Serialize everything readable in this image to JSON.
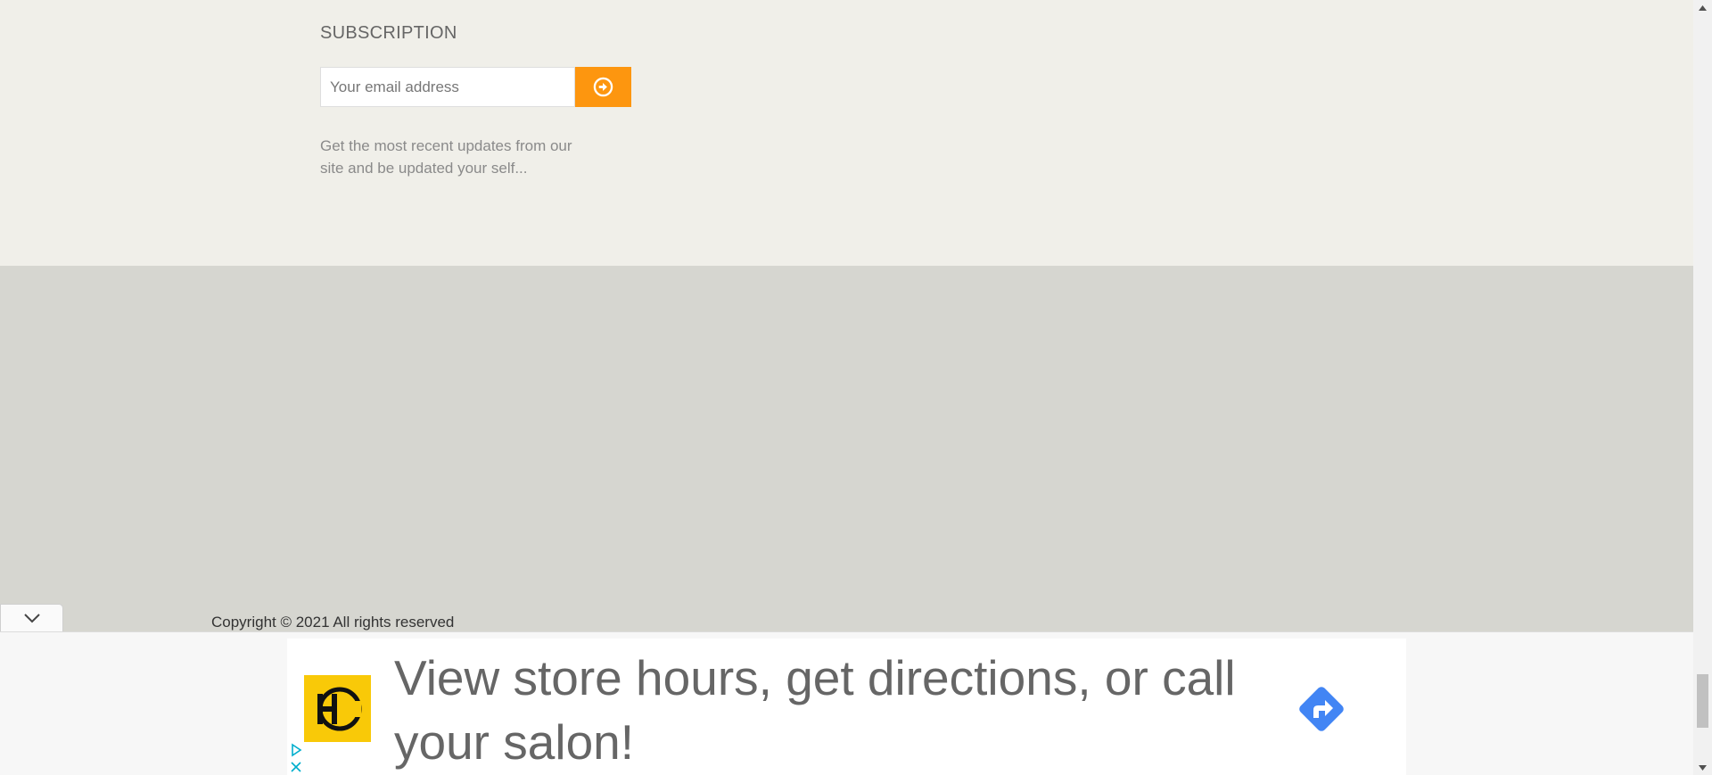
{
  "subscription": {
    "title": "SUBSCRIPTION",
    "email_placeholder": "Your email address",
    "submit_icon": "arrow-circle-right-icon",
    "description": "Get the most recent updates from our site and be updated your self..."
  },
  "footer": {
    "copyright": "Copyright © 2021 All rights reserved",
    "collapse_icon": "chevron-down-icon"
  },
  "ad": {
    "logo_text": "HC",
    "headline": "View store hours, get directions, or call your salon!",
    "direction_icon": "directions-icon",
    "adchoices_icon": "adchoices-icon",
    "close_icon": "close-icon"
  },
  "colors": {
    "accent": "#fd960f",
    "logo_bg": "#f9c908",
    "directions_blue": "#4285f4",
    "adchoices_blue": "#00aecd"
  }
}
